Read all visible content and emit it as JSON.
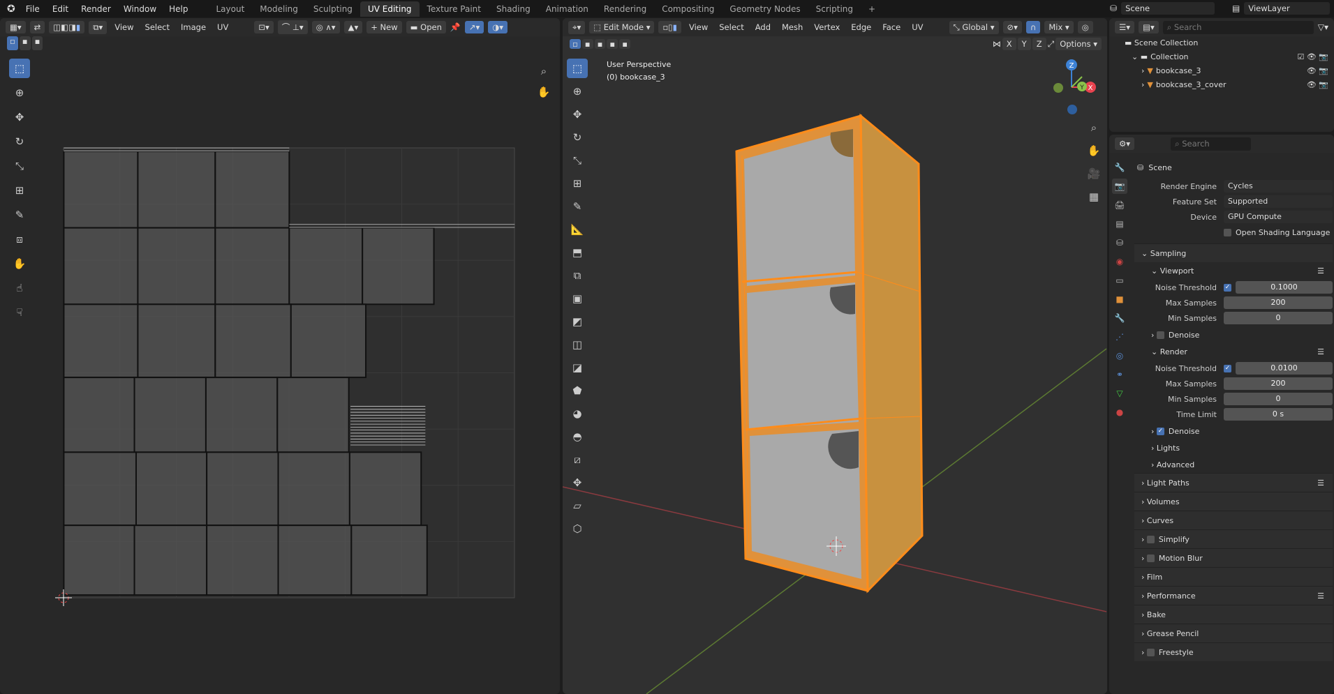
{
  "topbar": {
    "menus": [
      "File",
      "Edit",
      "Render",
      "Window",
      "Help"
    ],
    "workspaces": [
      "Layout",
      "Modeling",
      "Sculpting",
      "UV Editing",
      "Texture Paint",
      "Shading",
      "Animation",
      "Rendering",
      "Compositing",
      "Geometry Nodes",
      "Scripting"
    ],
    "active_workspace": "UV Editing",
    "add_tab": "+",
    "scene": "Scene",
    "view_layer": "ViewLayer"
  },
  "uv_editor": {
    "menus": [
      "View",
      "Select",
      "Image",
      "UV"
    ],
    "new_label": "New",
    "open_label": "Open"
  },
  "viewport": {
    "mode": "Edit Mode",
    "menus": [
      "View",
      "Select",
      "Add",
      "Mesh",
      "Vertex",
      "Edge",
      "Face",
      "UV"
    ],
    "orientation": "Global",
    "shading": "Mix",
    "axes": [
      "X",
      "Y",
      "Z"
    ],
    "options": "Options",
    "title": "User Perspective",
    "object": "(0) bookcase_3",
    "gizmo": {
      "z": "Z",
      "x": "X",
      "y": "Y"
    }
  },
  "outliner": {
    "search_placeholder": "Search",
    "scene_collection": "Scene Collection",
    "collection": "Collection",
    "items": [
      "bookcase_3",
      "bookcase_3_cover"
    ]
  },
  "properties": {
    "search_placeholder": "Search",
    "context": "Scene",
    "render_engine": {
      "label": "Render Engine",
      "value": "Cycles"
    },
    "feature_set": {
      "label": "Feature Set",
      "value": "Supported"
    },
    "device": {
      "label": "Device",
      "value": "GPU Compute"
    },
    "osl": "Open Shading Language",
    "sampling": "Sampling",
    "viewport": {
      "title": "Viewport",
      "noise_label": "Noise Threshold",
      "noise": "0.1000",
      "max_label": "Max Samples",
      "max": "200",
      "min_label": "Min Samples",
      "min": "0",
      "denoise": "Denoise"
    },
    "render": {
      "title": "Render",
      "noise_label": "Noise Threshold",
      "noise": "0.0100",
      "max_label": "Max Samples",
      "max": "200",
      "min_label": "Min Samples",
      "min": "0",
      "time_label": "Time Limit",
      "time": "0 s",
      "denoise": "Denoise"
    },
    "lights": "Lights",
    "advanced": "Advanced",
    "sections": [
      "Light Paths",
      "Volumes",
      "Curves",
      "Simplify",
      "Motion Blur",
      "Film",
      "Performance",
      "Bake",
      "Grease Pencil",
      "Freestyle"
    ]
  },
  "colors": {
    "accent": "#4772b3",
    "selection": "#ff8c1a",
    "x_axis": "#e8434f",
    "y_axis": "#8bc34a",
    "z_axis": "#3d82d6"
  }
}
